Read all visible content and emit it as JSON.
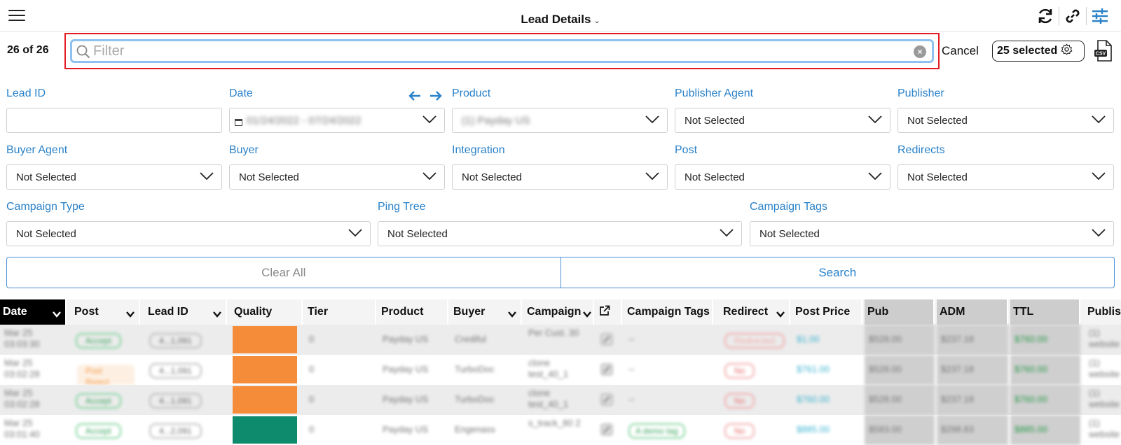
{
  "header": {
    "title": "Lead Details"
  },
  "toolbar": {
    "count": "26 of 26",
    "filter_placeholder": "Filter",
    "cancel_label": "Cancel",
    "selected_label": "25 selected"
  },
  "csv_label": "CSV",
  "form": {
    "lead_id": {
      "label": "Lead ID",
      "value": ""
    },
    "date": {
      "label": "Date",
      "value": "01/24/2022 - 07/24/2022"
    },
    "product": {
      "label": "Product",
      "value": "(1) Payday US"
    },
    "publisher_agent": {
      "label": "Publisher Agent",
      "value": "Not Selected"
    },
    "publisher": {
      "label": "Publisher",
      "value": "Not Selected"
    },
    "buyer_agent": {
      "label": "Buyer Agent",
      "value": "Not Selected"
    },
    "buyer": {
      "label": "Buyer",
      "value": "Not Selected"
    },
    "integration": {
      "label": "Integration",
      "value": "Not Selected"
    },
    "post": {
      "label": "Post",
      "value": "Not Selected"
    },
    "redirects": {
      "label": "Redirects",
      "value": "Not Selected"
    },
    "campaign_type": {
      "label": "Campaign Type",
      "value": "Not Selected"
    },
    "ping_tree": {
      "label": "Ping Tree",
      "value": "Not Selected"
    },
    "campaign_tags": {
      "label": "Campaign Tags",
      "value": "Not Selected"
    }
  },
  "actions": {
    "clear_all": "Clear All",
    "search": "Search"
  },
  "table": {
    "columns": [
      "Date",
      "Post",
      "Lead ID",
      "Quality",
      "Tier",
      "Product",
      "Buyer",
      "Campaign",
      "",
      "Campaign Tags",
      "Redirect",
      "Post Price",
      "Pub",
      "ADM",
      "TTL",
      "Publis"
    ],
    "rows": [
      {
        "date": "Mar 25 03:03:30",
        "post": "Accept",
        "lead": "4...1,091",
        "tier": "0",
        "product": "Payday US",
        "buyer": "Crediful",
        "campaign": "Per Cust. 30",
        "tags": "--",
        "redirect": "Redirected",
        "price": "$1.00",
        "pub": "$528.00",
        "adm": "$237.18",
        "ttl": "$760.00",
        "publis": "(1) website"
      },
      {
        "date": "Mar 25 03:02:28",
        "post": "Post Reject",
        "lead": "4...1,091",
        "tier": "0",
        "product": "Payday US",
        "buyer": "TurboDoc",
        "campaign": "clone test_40_1",
        "tags": "--",
        "redirect": "No",
        "price": "$761.00",
        "pub": "$528.00",
        "adm": "$237.18",
        "ttl": "$760.00",
        "publis": "(1) website"
      },
      {
        "date": "Mar 25 03:02:28",
        "post": "Accept",
        "lead": "4...1,091",
        "tier": "0",
        "product": "Payday US",
        "buyer": "TurboDoc",
        "campaign": "clone test_40_1",
        "tags": "--",
        "redirect": "No",
        "price": "$760.00",
        "pub": "$528.00",
        "adm": "$237.18",
        "ttl": "$760.00",
        "publis": "(1) website"
      },
      {
        "date": "Mar 25 03:01:40",
        "post": "Accept",
        "lead": "4...2,091",
        "tier": "0",
        "product": "Payday US",
        "buyer": "Engenass",
        "campaign": "s_track_80 2",
        "tags": "A demo tag",
        "redirect": "No",
        "price": "$885.00",
        "pub": "$583.00",
        "adm": "$298.83",
        "ttl": "$885.00",
        "publis": "(1) website"
      }
    ]
  },
  "colors": {
    "accent": "#2a82c9",
    "highlight_frame": "#e31b23",
    "quality_orange": "#f58c3a",
    "quality_green": "#0e8a6c"
  }
}
